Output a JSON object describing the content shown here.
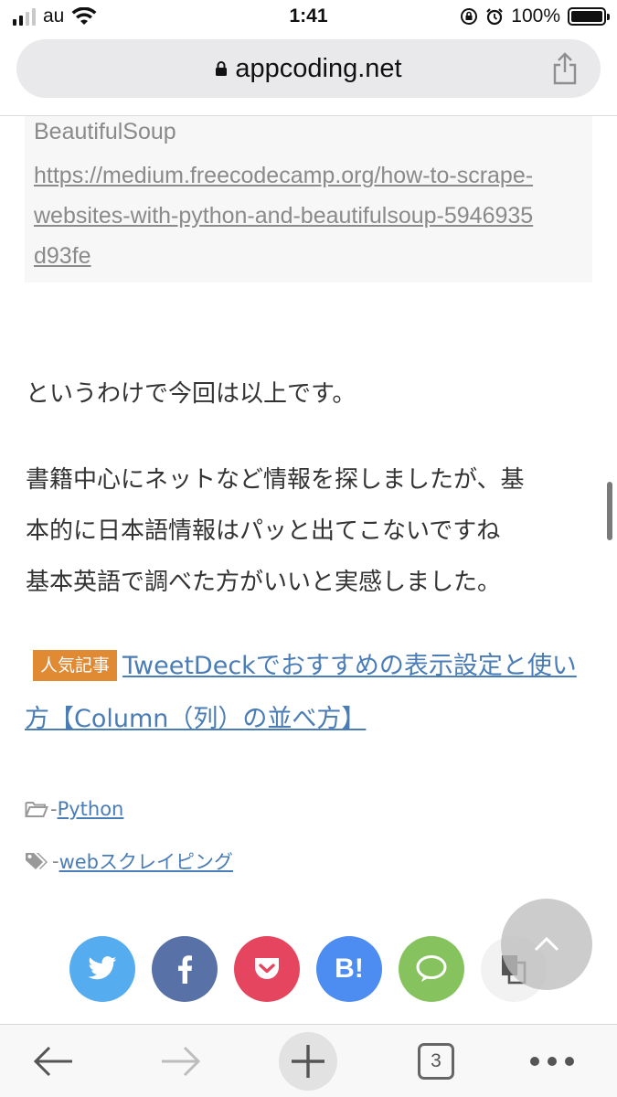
{
  "status_bar": {
    "carrier": "au",
    "time": "1:41",
    "battery": "100%"
  },
  "url_bar": {
    "domain": "appcoding.net"
  },
  "reference": {
    "label": "BeautifulSoup",
    "url": "https://medium.freecodecamp.org/how-to-scrape-websites-with-python-and-beautifulsoup-5946935d93fe"
  },
  "article": {
    "p1": "というわけで今回は以上です。",
    "p2_line1": "書籍中心にネットなど情報を探しましたが、基",
    "p2_line2": "本的に日本語情報はパッと出てこないですね",
    "p2_line3": "基本英語で調べた方がいいと実感しました。"
  },
  "popular": {
    "badge": "人気記事",
    "link": "TweetDeckでおすすめの表示設定と使い方【Column（列）の並べ方】"
  },
  "meta": {
    "category_prefix": "-",
    "category": "Python",
    "tag_prefix": "-",
    "tag": "webスクレイピング"
  },
  "share": {
    "hatena_label": "B!"
  },
  "toolbar": {
    "tab_count": "3"
  },
  "colors": {
    "link": "#4a7cb5",
    "badge": "#e08a34",
    "twitter": "#55acee",
    "facebook": "#3b5998",
    "pocket": "#e5455f",
    "hatena": "#4d8cf0",
    "line": "#86c35f"
  }
}
